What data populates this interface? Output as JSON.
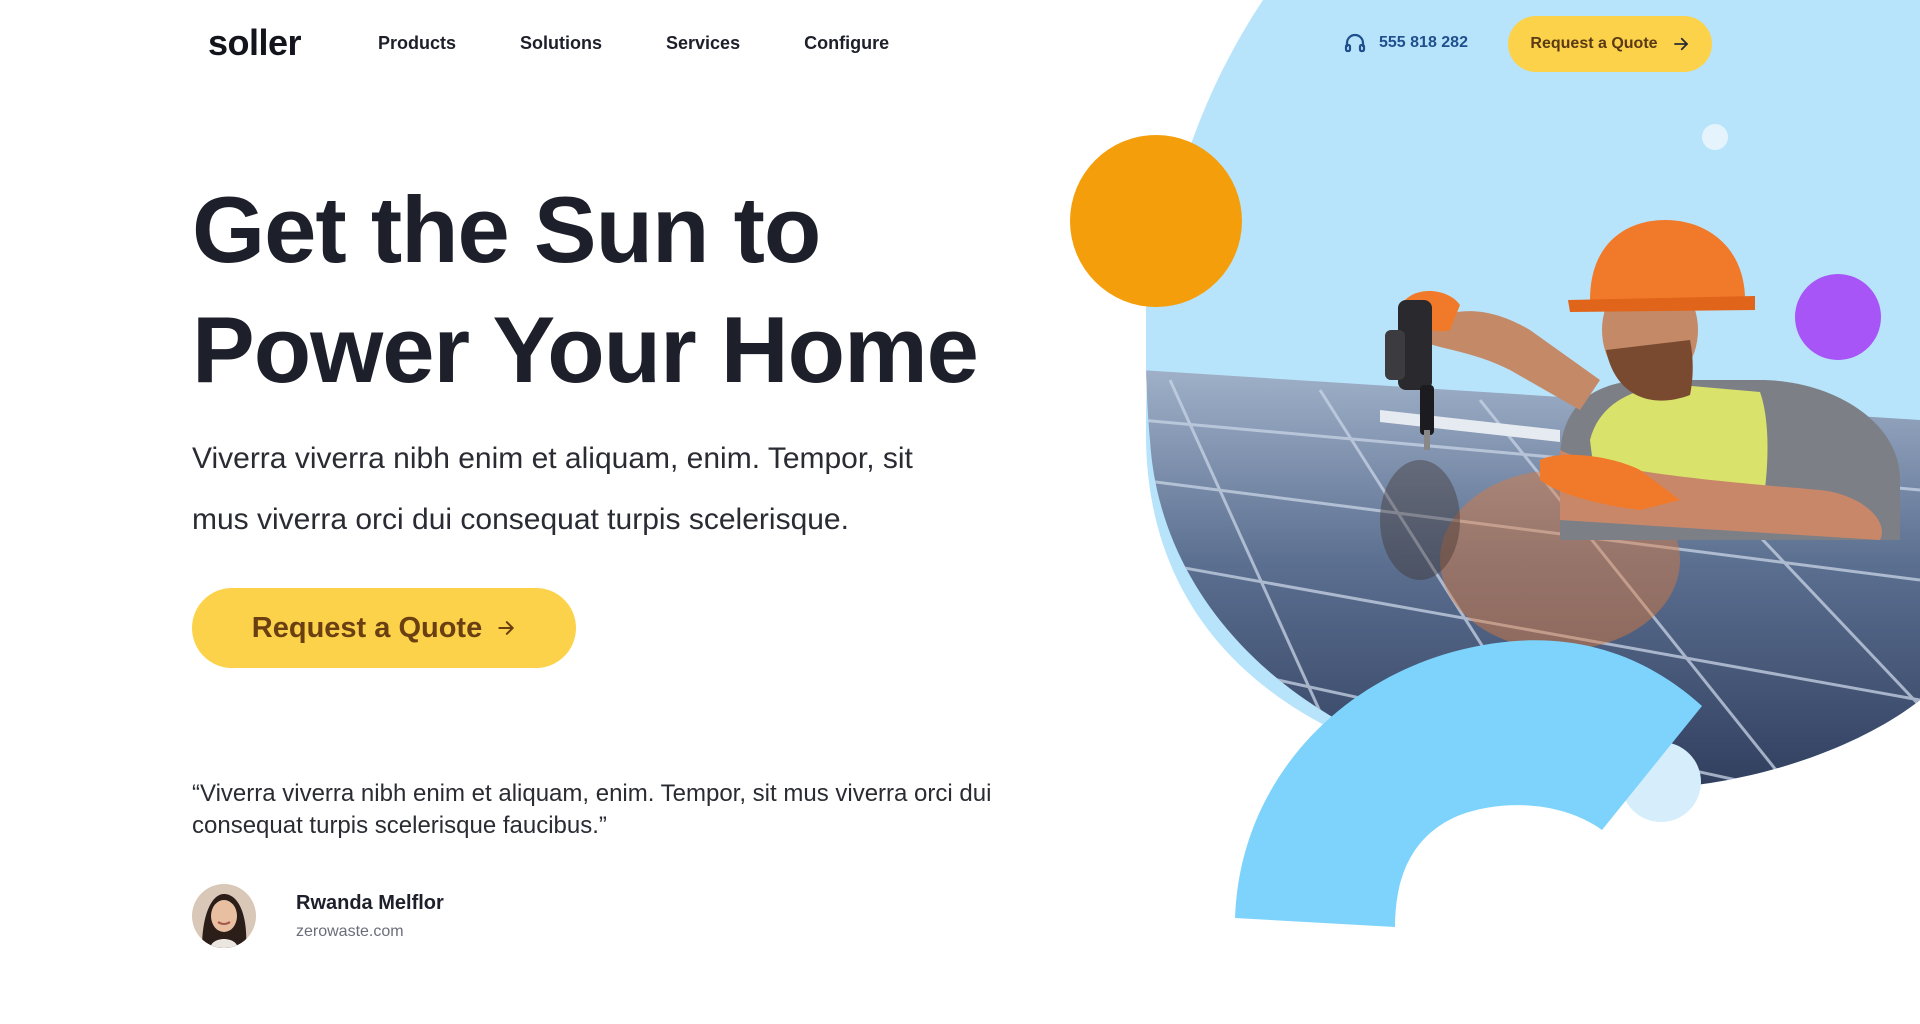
{
  "header": {
    "logo": "soller",
    "nav": [
      "Products",
      "Solutions",
      "Services",
      "Configure"
    ],
    "phone": "555 818 282",
    "cta_label": "Request a Quote"
  },
  "hero": {
    "title_line1": "Get the Sun to",
    "title_line2": "Power Your Home",
    "subtitle": "Viverra viverra nibh enim et aliquam, enim. Tempor, sit mus viverra orci dui consequat turpis scelerisque.",
    "cta_label": "Request a Quote"
  },
  "testimonial": {
    "quote": "“Viverra viverra nibh enim et aliquam, enim. Tempor, sit mus viverra orci dui consequat turpis scelerisque faucibus.”",
    "author_name": "Rwanda Melflor",
    "author_site": "zerowaste.com"
  },
  "icons": {
    "phone": "headset-icon",
    "arrow": "arrow-right-icon"
  },
  "colors": {
    "accent_yellow": "#fcd24a",
    "blob_light_blue": "#b8e4fb",
    "arc_blue": "#7dd3fb",
    "circle_orange": "#f59e0b",
    "circle_purple": "#a855f7",
    "text_dark": "#1d1f2a"
  }
}
